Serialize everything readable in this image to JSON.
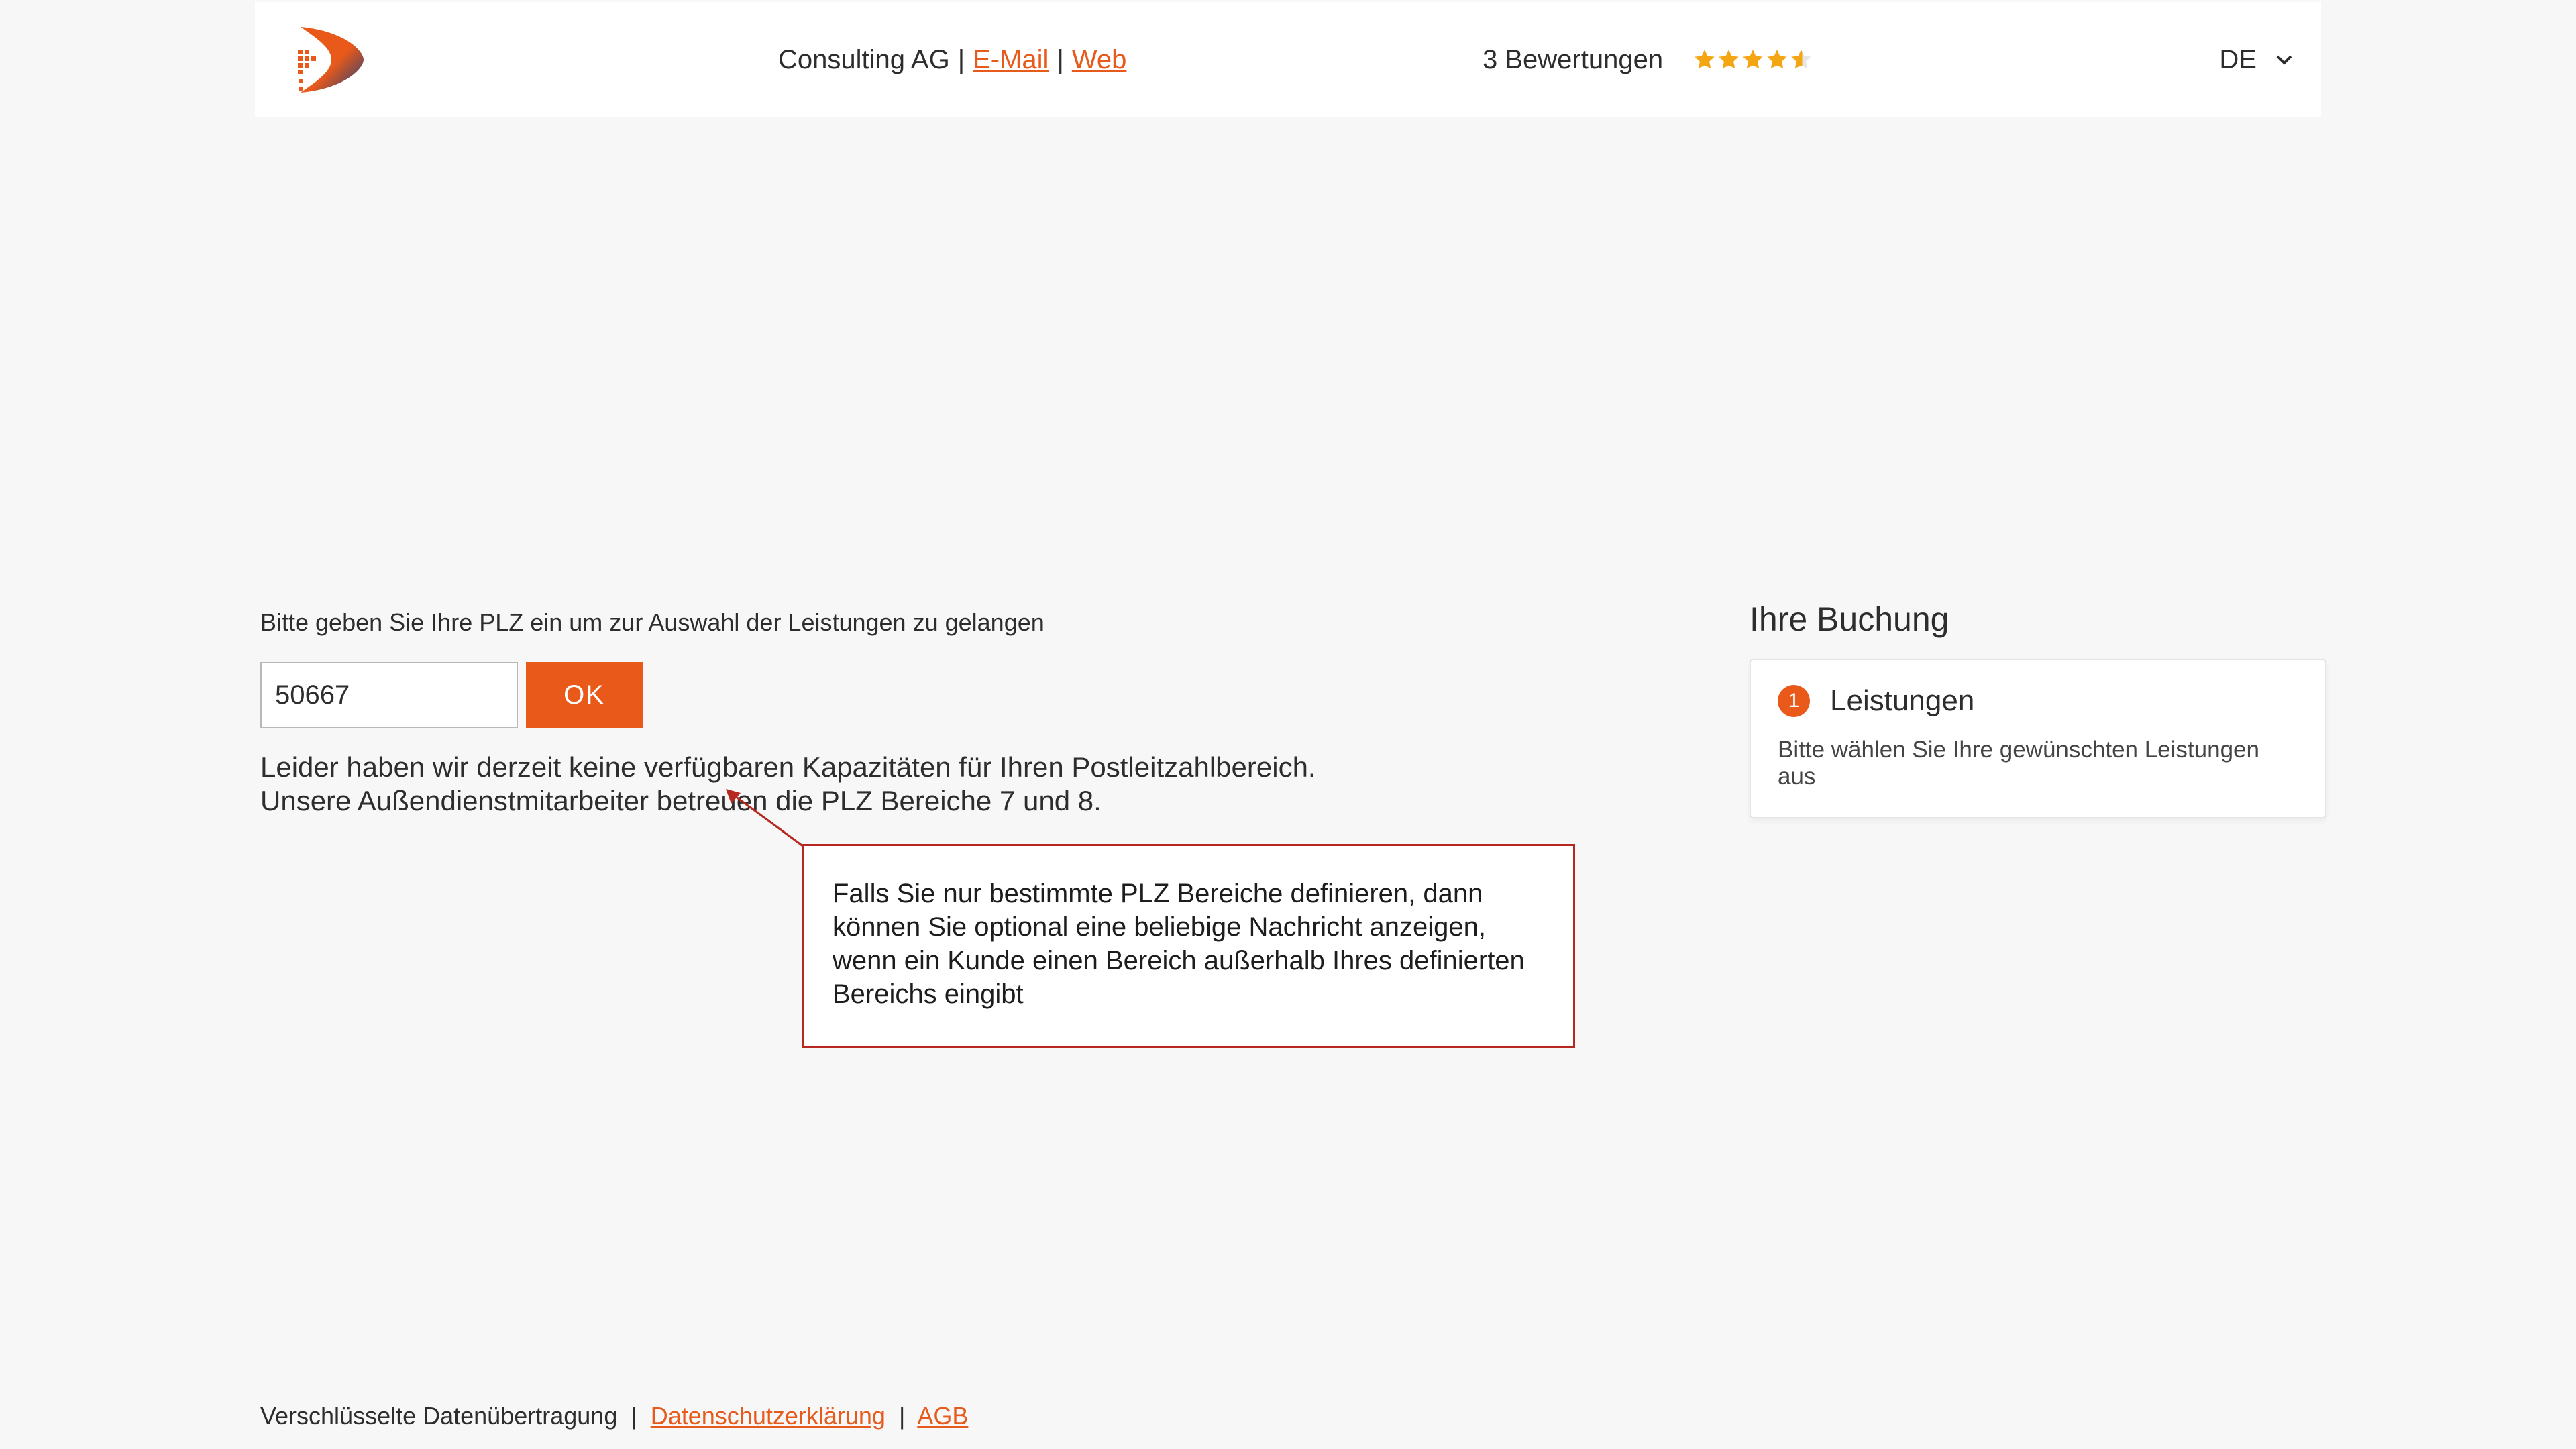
{
  "header": {
    "company": "Consulting AG",
    "email_label": "E-Mail",
    "web_label": "Web",
    "ratings_text": "3 Bewertungen",
    "rating_value": 4.5,
    "lang": "DE"
  },
  "plz": {
    "prompt": "Bitte geben Sie Ihre PLZ ein um zur Auswahl der Leistungen zu gelangen",
    "value": "50667",
    "ok_label": "OK",
    "error_line1": "Leider haben wir derzeit keine verfügbaren Kapazitäten für Ihren Postleitzahlbereich.",
    "error_line2": "Unsere Außendienstmitarbeiter betreuen die PLZ Bereiche 7 und 8."
  },
  "annotation": {
    "text": "Falls Sie nur bestimmte PLZ Bereiche definieren, dann können Sie optional eine beliebige Nachricht anzeigen, wenn ein Kunde einen Bereich außerhalb Ihres definierten Bereichs eingibt"
  },
  "sidebar": {
    "title": "Ihre Buchung",
    "step_num": "1",
    "step_label": "Leistungen",
    "step_desc": "Bitte wählen Sie Ihre gewünschten Leistungen aus"
  },
  "footer": {
    "secure": "Verschlüsselte Datenübertragung",
    "privacy": "Datenschutzerklärung",
    "terms": "AGB"
  }
}
